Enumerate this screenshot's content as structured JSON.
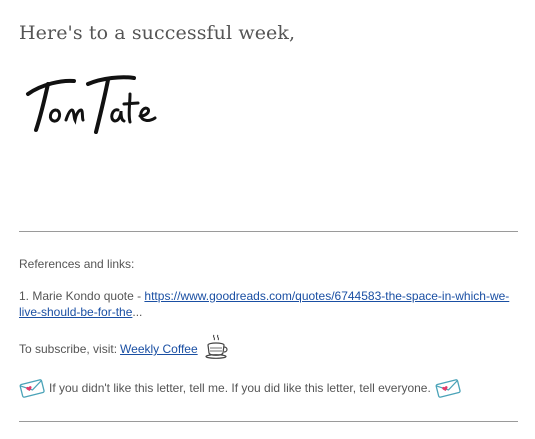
{
  "closing": "Here's to a successful week,",
  "signature_text": "Tom Tate",
  "references": {
    "heading": "References and links:",
    "items": [
      {
        "prefix": "1. Marie Kondo quote - ",
        "link_text_line1": "https://www.goodreads.com/quotes/6744583-the-space-in-which-we-",
        "link_text_line2": "live-should-be-for-the",
        "ellipsis": "..."
      }
    ]
  },
  "subscribe": {
    "label": "To subscribe, visit:",
    "link_text": "Weekly Coffee",
    "icon": "coffee-cup-icon"
  },
  "feedback": {
    "text": "If you didn't like this letter, tell me. If you did like this letter, tell everyone.",
    "icon": "love-letter-envelope-icon"
  },
  "colors": {
    "text": "#555555",
    "link": "#1a4fa3",
    "rule": "#9a9a9a",
    "envelope_accent": "#e23b6a"
  }
}
